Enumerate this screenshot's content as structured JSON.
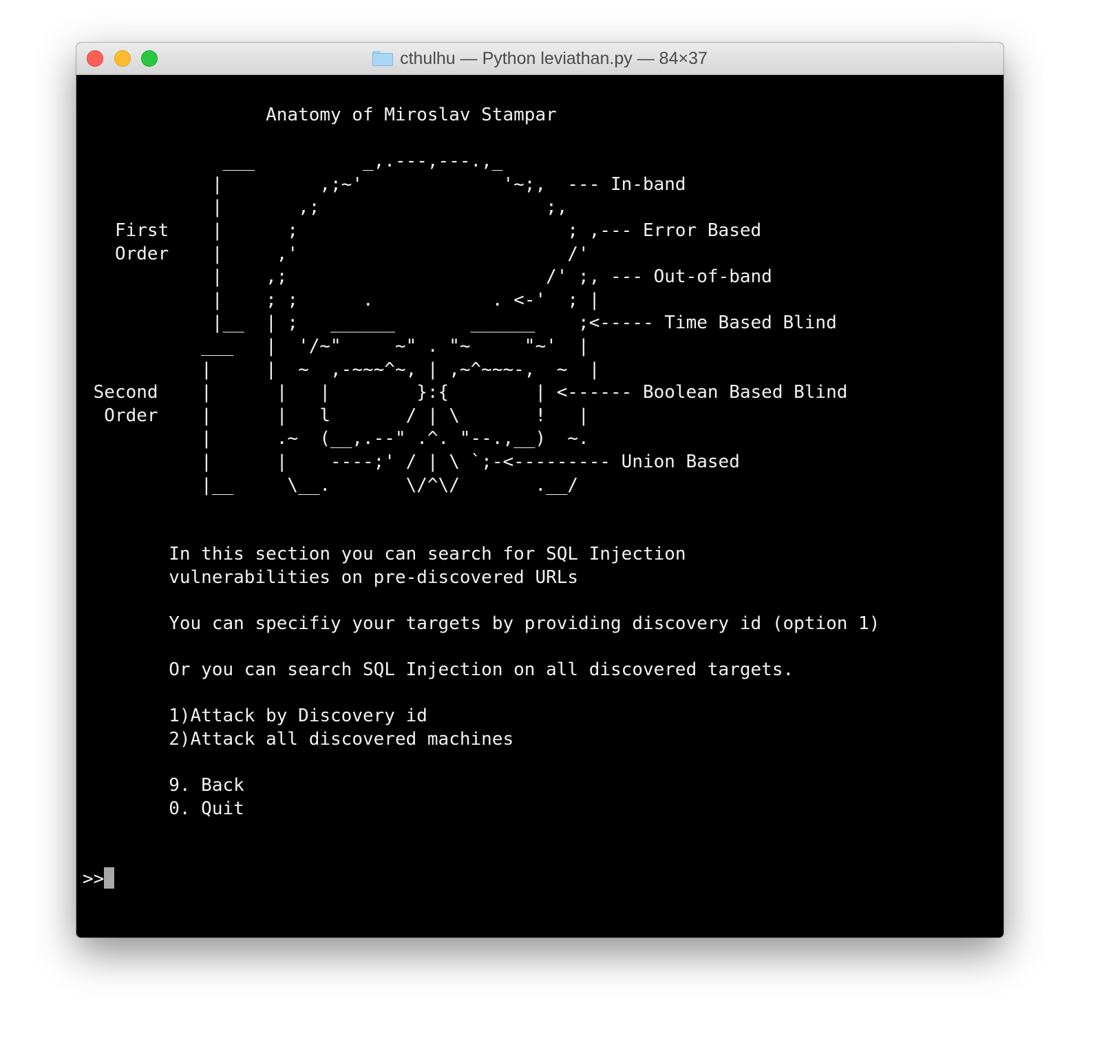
{
  "window": {
    "title": "cthulhu — Python leviathan.py — 84×37",
    "folder_icon": "folder-icon"
  },
  "terminal": {
    "lines": [
      "                 Anatomy of Miroslav Stampar",
      "",
      "             ___          _,.---,---.,_",
      "            |         ,;~'             '~;,  --- In-band",
      "            |       ,;                     ;,",
      "   First    |      ;                         ; ,--- Error Based",
      "   Order    |     ,'                         /'",
      "            |    ,;                        /' ;, --- Out-of-band",
      "            |    ; ;      .           . <-'  ; |",
      "            |__  | ;   ______       ______    ;<----- Time Based Blind",
      "           ___   |  '/~\"     ~\" . \"~     \"~'  |",
      "           |     |  ~  ,-~~~^~, | ,~^~~~-,  ~  |",
      " Second    |      |   |        }:{        | <------ Boolean Based Blind",
      "  Order    |      |   l       / | \\       !   |",
      "           |      .~  (__,.--\" .^. \"--.,__)  ~.",
      "           |      |    ----;' / | \\ `;-<--------- Union Based",
      "           |__     \\__.       \\/^\\/       .__/",
      "",
      "",
      "        In this section you can search for SQL Injection",
      "        vulnerabilities on pre-discovered URLs",
      "",
      "        You can specifiy your targets by providing discovery id (option 1)",
      "",
      "        Or you can search SQL Injection on all discovered targets.",
      "",
      "        1)Attack by Discovery id",
      "        2)Attack all discovered machines",
      "",
      "        9. Back",
      "        0. Quit",
      "",
      ""
    ],
    "prompt": ">>"
  }
}
